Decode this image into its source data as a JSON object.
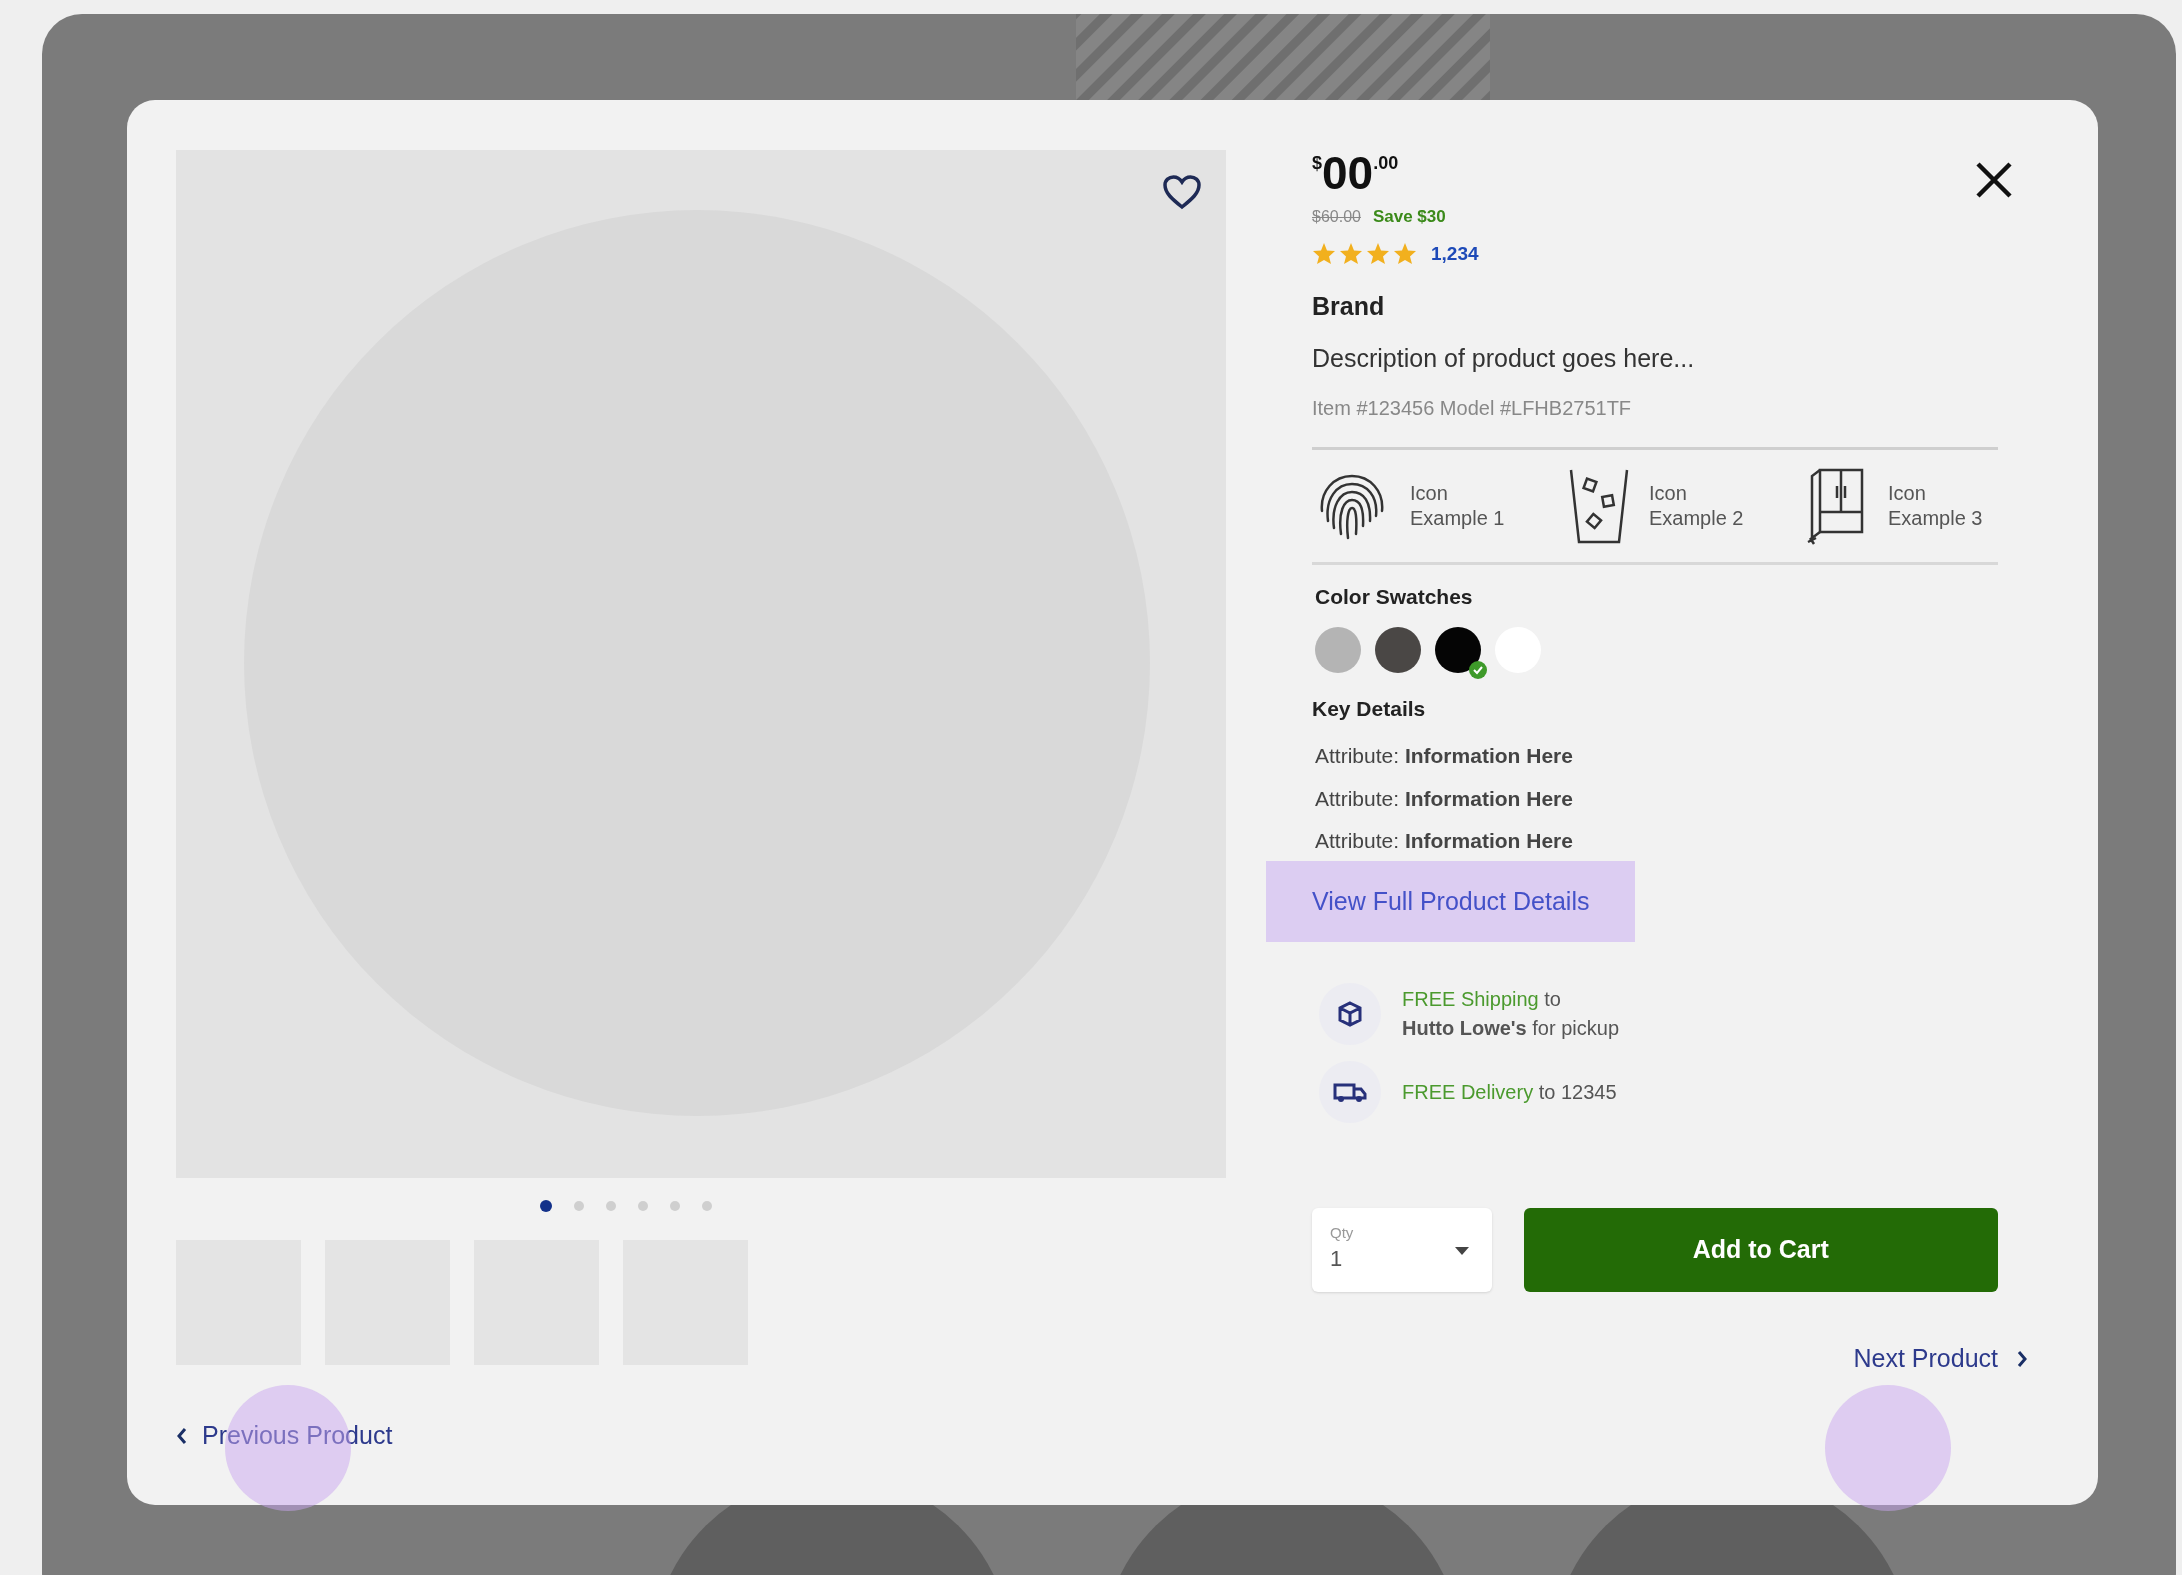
{
  "gallery": {
    "image": {
      "kind": "placeholder"
    },
    "favorite": {
      "on": false
    },
    "dots": [
      {
        "selected": true
      },
      {
        "selected": false
      },
      {
        "selected": false
      },
      {
        "selected": false
      },
      {
        "selected": false
      },
      {
        "selected": false
      }
    ],
    "thumbnails": [
      {
        "kind": "placeholder"
      },
      {
        "kind": "placeholder"
      },
      {
        "kind": "placeholder"
      },
      {
        "kind": "placeholder"
      }
    ]
  },
  "price": {
    "currency": "$",
    "dollars": "00",
    "cents": ".00",
    "was": "$60.00",
    "save": "Save $30"
  },
  "rating": {
    "stars": 4,
    "count": "1,234"
  },
  "brand": "Brand",
  "description": "Description of product goes here...",
  "item_model": "Item #123456 Model #LFHB2751TF",
  "features": [
    {
      "kind": "fingerprint",
      "label": "Icon Example 1"
    },
    {
      "kind": "glass",
      "label": "Icon Example 2"
    },
    {
      "kind": "fridge",
      "label": "Icon Example 3"
    }
  ],
  "swatches": {
    "title": "Color Swatches",
    "items": [
      {
        "color": "#b4b4b4",
        "selected": false
      },
      {
        "color": "#4a4745",
        "selected": false
      },
      {
        "color": "#050505",
        "selected": true
      },
      {
        "color": "#ffffff",
        "selected": false
      }
    ]
  },
  "key_details": {
    "title": "Key Details",
    "rows": [
      "Attribute: **Information Here**",
      "Attribute: **Information Here**",
      "Attribute: **Information Here**"
    ]
  },
  "full_details_link": "View Full Product Details",
  "fulfillment": [
    {
      "kind": "shipping",
      "highlight": "FREE Shipping",
      "rest": " to",
      "line2": "**Hutto Lowe's** for pickup"
    },
    {
      "kind": "delivery",
      "highlight": "FREE Delivery",
      "rest": " to 12345"
    }
  ],
  "qty": {
    "label": "Qty",
    "value": "1"
  },
  "add_to_cart": "Add to Cart",
  "nav": {
    "previous": "Previous Product",
    "next": "Next Product"
  }
}
